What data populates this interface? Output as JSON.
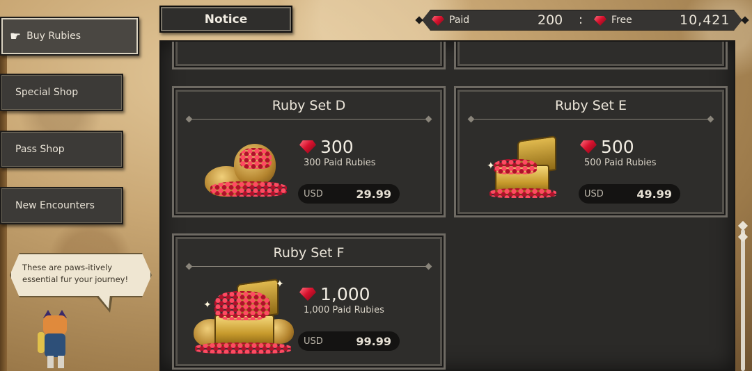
{
  "sidebar": {
    "items": [
      {
        "label": "Buy Rubies",
        "active": true
      },
      {
        "label": "Special Shop",
        "active": false
      },
      {
        "label": "Pass Shop",
        "active": false
      },
      {
        "label": "New Encounters",
        "active": false
      }
    ]
  },
  "header": {
    "notice_label": "Notice"
  },
  "currency": {
    "paid_label": "Paid",
    "paid_value": "200",
    "separator": ":",
    "free_label": "Free",
    "free_value": "10,421"
  },
  "shop": {
    "items": [
      {
        "title": "Ruby Set D",
        "amount": "300",
        "subtitle": "300 Paid Rubies",
        "currency": "USD",
        "price": "29.99",
        "art": "ruby-sack-icon"
      },
      {
        "title": "Ruby Set E",
        "amount": "500",
        "subtitle": "500 Paid Rubies",
        "currency": "USD",
        "price": "49.99",
        "art": "ruby-chest-icon"
      },
      {
        "title": "Ruby Set F",
        "amount": "1,000",
        "subtitle": "1,000 Paid Rubies",
        "currency": "USD",
        "price": "99.99",
        "art": "ruby-treasure-pile-icon"
      }
    ]
  },
  "guide": {
    "speech": "These are paws-itively essential fur your journey!"
  },
  "colors": {
    "ruby": "#d8122e",
    "panel": "#2b2a28",
    "parchment": "#c9a774"
  }
}
